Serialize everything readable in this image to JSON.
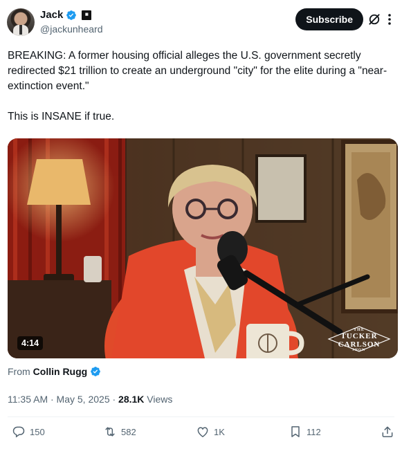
{
  "author": {
    "name": "Jack",
    "handle": "@jackunheard"
  },
  "subscribe_label": "Subscribe",
  "tweet": {
    "paragraph1": "BREAKING: A former housing official alleges the U.S. government secretly redirected $21 trillion to create an underground \"city\" for the elite during a \"near-extinction event.\"",
    "paragraph2": "This is INSANE if true."
  },
  "video": {
    "duration": "4:14",
    "watermark_line1": "THE",
    "watermark_line2": "TUCKER",
    "watermark_line3": "CARLSON",
    "watermark_line4": "SHOW"
  },
  "source": {
    "prefix": "From",
    "name": "Collin Rugg"
  },
  "meta": {
    "datetime": "11:35 AM · May 5, 2025 · ",
    "views_count": "28.1K",
    "views_label": " Views"
  },
  "actions": {
    "replies": "150",
    "reposts": "582",
    "likes": "1K",
    "bookmarks": "112"
  },
  "colors": {
    "text": "#0f1419",
    "secondary": "#536471",
    "verified": "#1d9bf0",
    "subscribe_bg": "#0f1419"
  }
}
